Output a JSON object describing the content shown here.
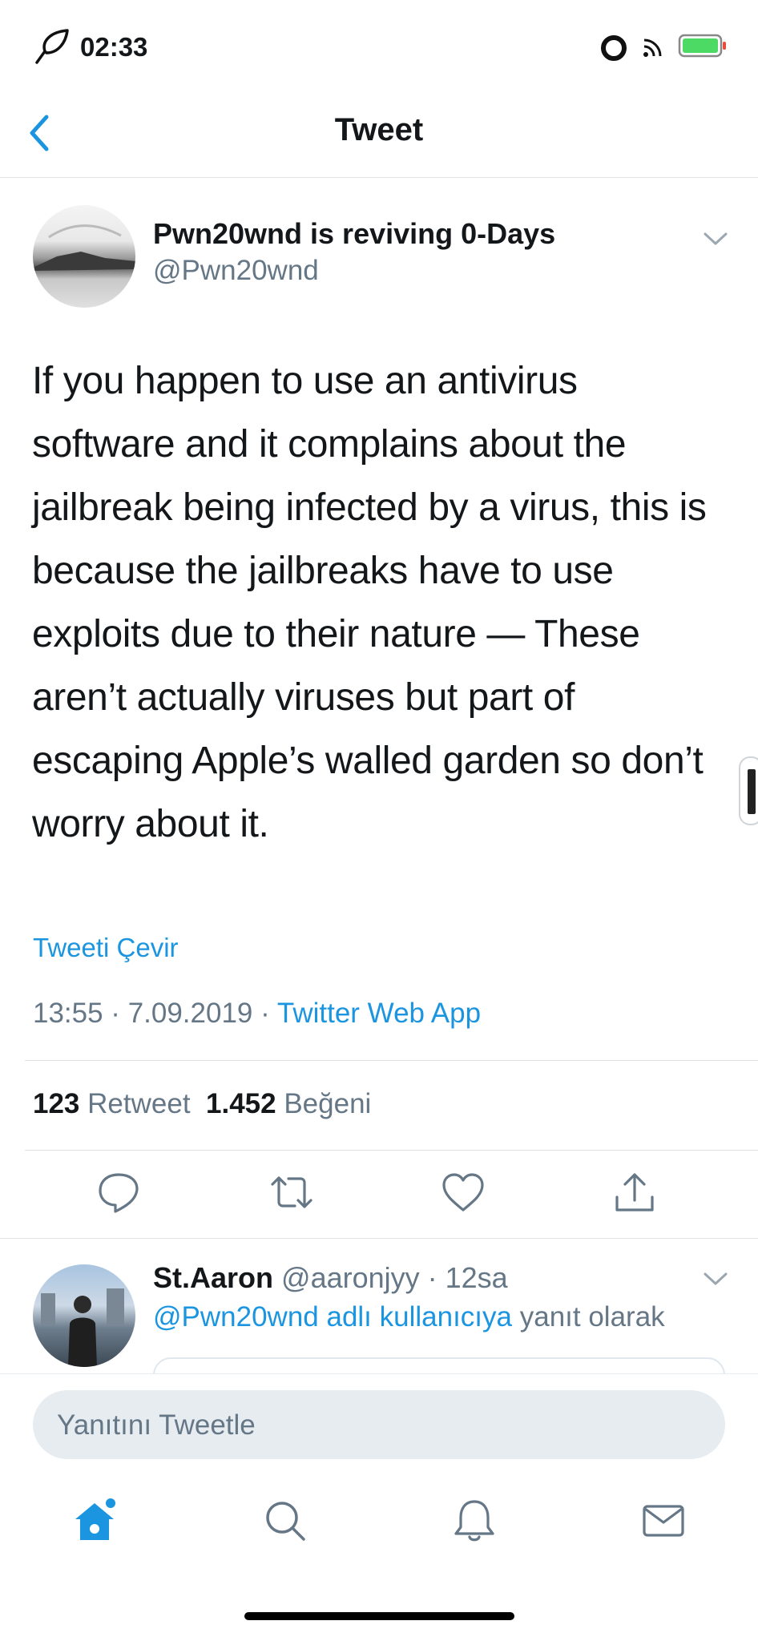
{
  "status_bar": {
    "time": "02:33"
  },
  "nav": {
    "title": "Tweet"
  },
  "tweet": {
    "author_name": "Pwn20wnd is reviving 0-Days",
    "author_handle": "@Pwn20wnd",
    "text": "If you happen to use an antivirus software and it complains about the jailbreak being infected by a virus, this is because the jailbreaks have to use exploits due to their nature — These aren’t actually viruses but part of escaping Apple’s walled garden so don’t worry about it.",
    "translate_label": "Tweeti Çevir",
    "timestamp": "13:55 · 7.09.2019 · ",
    "source": "Twitter Web App",
    "retweet_count": "123",
    "retweet_label": "Retweet",
    "like_count": "1.452",
    "like_label": "Beğeni"
  },
  "reply": {
    "author_name": "St.Aaron",
    "author_handle_time": "@aaronjyy · 12sa",
    "mention": "@Pwn20wnd adlı kullanıcıya",
    "context_suffix": " yanıt olarak"
  },
  "compose": {
    "placeholder": "Yanıtını Tweetle"
  },
  "colors": {
    "accent": "#1b95e0",
    "secondary_text": "#657786",
    "battery": "#4cd964"
  },
  "icons": {
    "nav_back": "chevron-left-icon",
    "tabs": [
      "home-icon",
      "search-icon",
      "bell-icon",
      "mail-icon"
    ],
    "actions": [
      "reply-icon",
      "retweet-icon",
      "like-icon",
      "share-icon"
    ]
  }
}
